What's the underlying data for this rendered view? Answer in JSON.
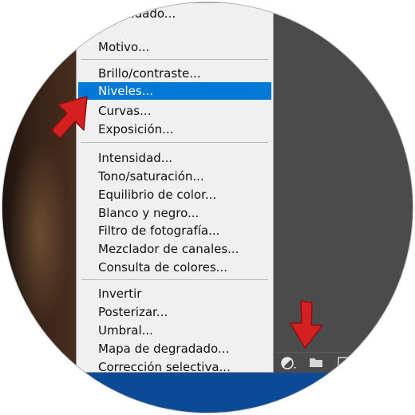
{
  "menu": {
    "items": [
      {
        "label": "Degradado..."
      },
      {
        "label": "Motivo..."
      },
      {
        "label": "Brillo/contraste..."
      },
      {
        "label": "Niveles..."
      },
      {
        "label": "Curvas..."
      },
      {
        "label": "Exposición..."
      },
      {
        "label": "Intensidad..."
      },
      {
        "label": "Tono/saturación..."
      },
      {
        "label": "Equilibrio de color..."
      },
      {
        "label": "Blanco y negro..."
      },
      {
        "label": "Filtro de fotografía..."
      },
      {
        "label": "Mezclador de canales..."
      },
      {
        "label": "Consulta de colores..."
      },
      {
        "label": "Invertir"
      },
      {
        "label": "Posterizar..."
      },
      {
        "label": "Umbral..."
      },
      {
        "label": "Mapa de degradado..."
      },
      {
        "label": "Corrección selectiva..."
      }
    ],
    "selected_label": "Niveles...",
    "highlight_color": "#0078d7"
  },
  "panel_toolbar": {
    "icons": [
      "adjustment-layer-icon",
      "folder-icon",
      "new-layer-icon"
    ]
  },
  "annotation_color": "#d42020"
}
